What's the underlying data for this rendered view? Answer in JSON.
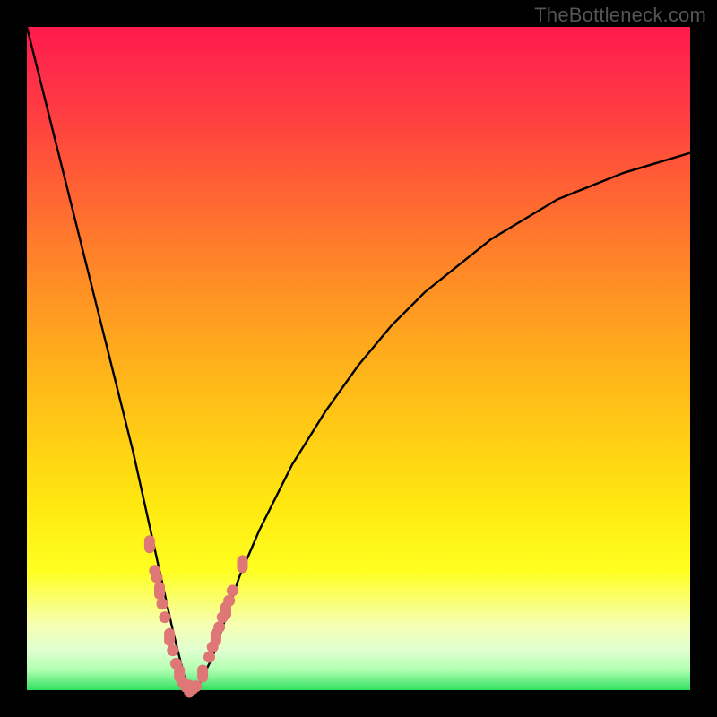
{
  "watermark": "TheBottleneck.com",
  "colors": {
    "frame": "#000000",
    "curve": "#000000",
    "marker": "#e07777",
    "gradient_top": "#ff1a4d",
    "gradient_bottom": "#30e060"
  },
  "chart_data": {
    "type": "line",
    "title": "",
    "xlabel": "",
    "ylabel": "",
    "xlim": [
      0,
      100
    ],
    "ylim": [
      0,
      100
    ],
    "x": [
      0,
      2,
      4,
      6,
      8,
      10,
      12,
      14,
      16,
      18,
      20,
      22,
      23,
      24,
      25,
      26,
      28,
      30,
      32,
      35,
      40,
      45,
      50,
      55,
      60,
      65,
      70,
      75,
      80,
      85,
      90,
      95,
      100
    ],
    "y": [
      100,
      92,
      84,
      76,
      68,
      60,
      52,
      44,
      36,
      27,
      18,
      9,
      5,
      1,
      0,
      1,
      5,
      11,
      17,
      24,
      34,
      42,
      49,
      55,
      60,
      64,
      68,
      71,
      74,
      76,
      78,
      79.5,
      81
    ],
    "note": "Single V-shaped bottleneck curve; minimum (0%) at x≈24–25. Right branch rises and flattens asymptotically. Values are percentages estimated from plot geometry (no printed axis ticks).",
    "markers_x": [
      18.5,
      19.3,
      19.6,
      20.0,
      20.4,
      20.8,
      21.5,
      22.0,
      22.5,
      23.0,
      23.5,
      24.0,
      24.5,
      25.0,
      25.5,
      26.5,
      27.5,
      28.0,
      28.5,
      29.0,
      29.5,
      30.0,
      30.5,
      31.0,
      32.5
    ],
    "markers_y": [
      22,
      18,
      17,
      15,
      13,
      11,
      8,
      6,
      4,
      2.5,
      1.2,
      0.5,
      0.2,
      0.2,
      0.6,
      2.5,
      5,
      6.5,
      8,
      9.5,
      11,
      12,
      13.5,
      15,
      19
    ],
    "markers_note": "Salmon-colored dot/pill markers clustered near the valley of the curve."
  }
}
